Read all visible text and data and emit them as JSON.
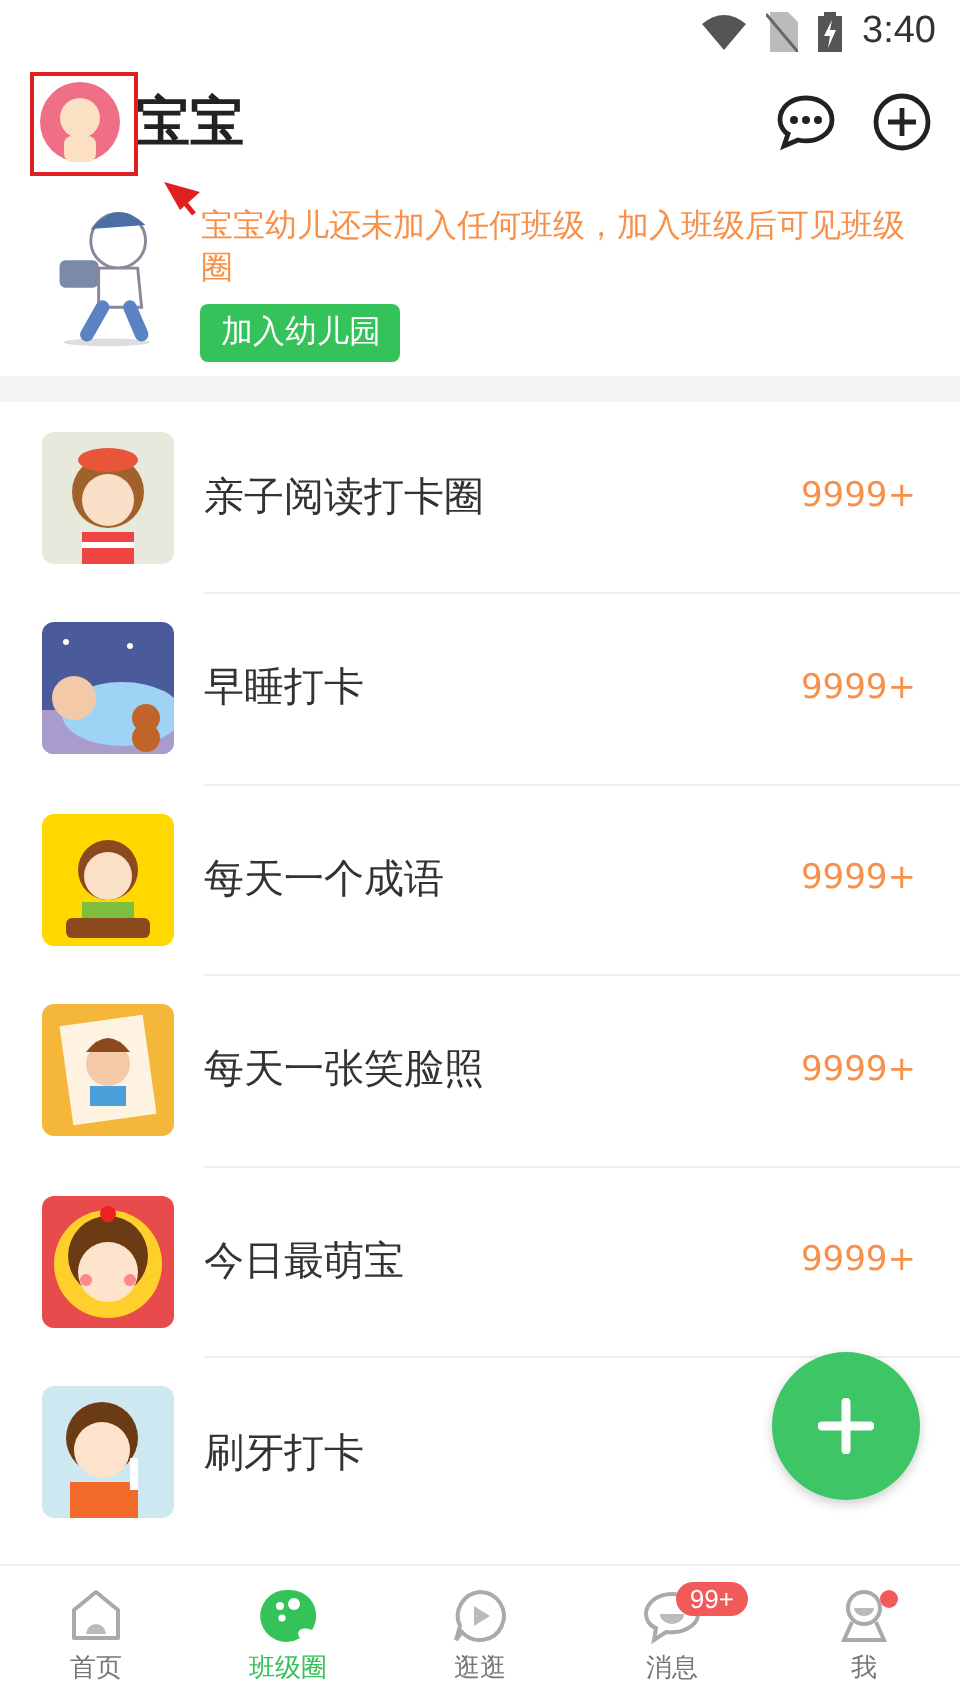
{
  "status_bar": {
    "time": "3:40"
  },
  "header": {
    "title": "宝宝"
  },
  "notice": {
    "message": "宝宝幼儿还未加入任何班级，加入班级后可见班级圈",
    "button": "加入幼儿园"
  },
  "circles": [
    {
      "name": "亲子阅读打卡圈",
      "count": "9999+"
    },
    {
      "name": "早睡打卡",
      "count": "9999+"
    },
    {
      "name": "每天一个成语",
      "count": "9999+"
    },
    {
      "name": "每天一张笑脸照",
      "count": "9999+"
    },
    {
      "name": "今日最萌宝",
      "count": "9999+"
    },
    {
      "name": "刷牙打卡"
    }
  ],
  "tab_bar": [
    {
      "label": "首页",
      "selected": false
    },
    {
      "label": "班级圈",
      "selected": true
    },
    {
      "label": "逛逛",
      "selected": false
    },
    {
      "label": "消息",
      "selected": false,
      "badge": "99+"
    },
    {
      "label": "我",
      "selected": false,
      "dot": true
    }
  ]
}
